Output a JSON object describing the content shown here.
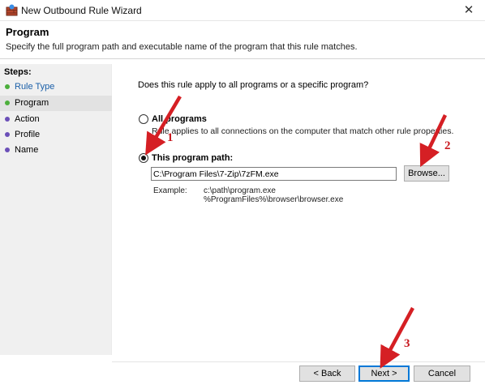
{
  "window": {
    "title": "New Outbound Rule Wizard",
    "close_glyph": "✕",
    "icon": "firewall-icon"
  },
  "header": {
    "title": "Program",
    "description": "Specify the full program path and executable name of the program that this rule matches."
  },
  "steps": {
    "title": "Steps:",
    "items": [
      {
        "label": "Rule Type",
        "dot_color": "#4caf3c",
        "link": true
      },
      {
        "label": "Program",
        "dot_color": "#4caf3c",
        "active": true
      },
      {
        "label": "Action",
        "dot_color": "#6b4fb8"
      },
      {
        "label": "Profile",
        "dot_color": "#6b4fb8"
      },
      {
        "label": "Name",
        "dot_color": "#6b4fb8"
      }
    ]
  },
  "main": {
    "question": "Does this rule apply to all programs or a specific program?",
    "option_all": {
      "label": "All programs",
      "description": "Rule applies to all connections on the computer that match other rule properties.",
      "checked": false
    },
    "option_path": {
      "label": "This program path:",
      "checked": true
    },
    "path_value": "C:\\Program Files\\7-Zip\\7zFM.exe",
    "browse_label": "Browse...",
    "example_label": "Example:",
    "example_lines": [
      "c:\\path\\program.exe",
      "%ProgramFiles%\\browser\\browser.exe"
    ]
  },
  "footer": {
    "back_label": "< Back",
    "next_label": "Next >",
    "cancel_label": "Cancel"
  },
  "annotations": {
    "color": "#c8191f",
    "numbers": [
      "1",
      "2",
      "3"
    ]
  }
}
